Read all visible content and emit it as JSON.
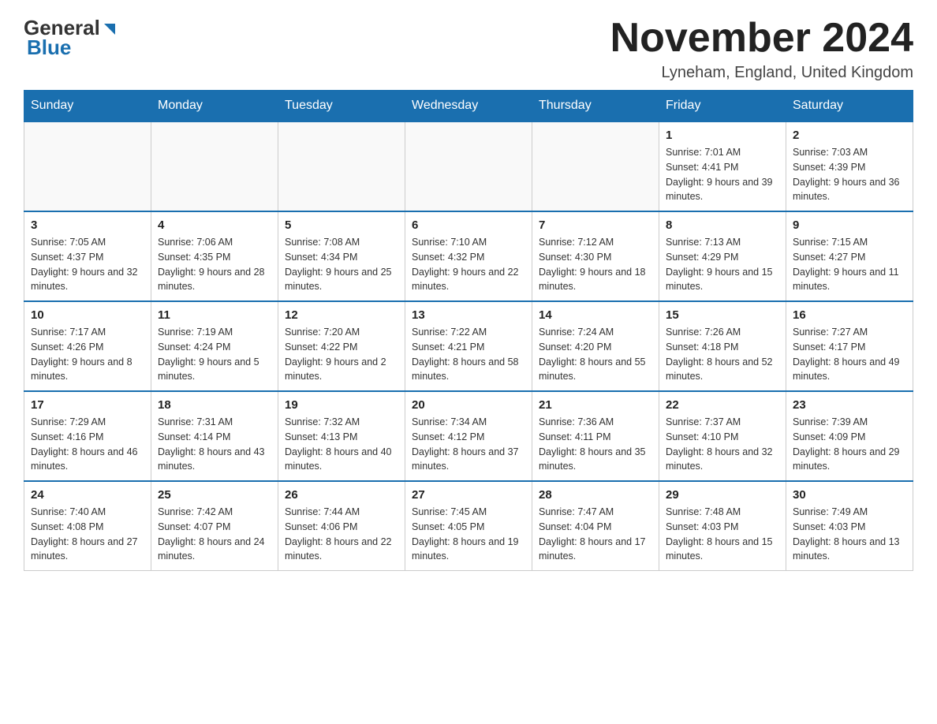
{
  "header": {
    "logo_text_general": "General",
    "logo_text_blue": "Blue",
    "month_title": "November 2024",
    "location": "Lyneham, England, United Kingdom"
  },
  "days_of_week": [
    "Sunday",
    "Monday",
    "Tuesday",
    "Wednesday",
    "Thursday",
    "Friday",
    "Saturday"
  ],
  "weeks": [
    [
      {
        "day": "",
        "sunrise": "",
        "sunset": "",
        "daylight": "",
        "empty": true
      },
      {
        "day": "",
        "sunrise": "",
        "sunset": "",
        "daylight": "",
        "empty": true
      },
      {
        "day": "",
        "sunrise": "",
        "sunset": "",
        "daylight": "",
        "empty": true
      },
      {
        "day": "",
        "sunrise": "",
        "sunset": "",
        "daylight": "",
        "empty": true
      },
      {
        "day": "",
        "sunrise": "",
        "sunset": "",
        "daylight": "",
        "empty": true
      },
      {
        "day": "1",
        "sunrise": "Sunrise: 7:01 AM",
        "sunset": "Sunset: 4:41 PM",
        "daylight": "Daylight: 9 hours and 39 minutes.",
        "empty": false
      },
      {
        "day": "2",
        "sunrise": "Sunrise: 7:03 AM",
        "sunset": "Sunset: 4:39 PM",
        "daylight": "Daylight: 9 hours and 36 minutes.",
        "empty": false
      }
    ],
    [
      {
        "day": "3",
        "sunrise": "Sunrise: 7:05 AM",
        "sunset": "Sunset: 4:37 PM",
        "daylight": "Daylight: 9 hours and 32 minutes.",
        "empty": false
      },
      {
        "day": "4",
        "sunrise": "Sunrise: 7:06 AM",
        "sunset": "Sunset: 4:35 PM",
        "daylight": "Daylight: 9 hours and 28 minutes.",
        "empty": false
      },
      {
        "day": "5",
        "sunrise": "Sunrise: 7:08 AM",
        "sunset": "Sunset: 4:34 PM",
        "daylight": "Daylight: 9 hours and 25 minutes.",
        "empty": false
      },
      {
        "day": "6",
        "sunrise": "Sunrise: 7:10 AM",
        "sunset": "Sunset: 4:32 PM",
        "daylight": "Daylight: 9 hours and 22 minutes.",
        "empty": false
      },
      {
        "day": "7",
        "sunrise": "Sunrise: 7:12 AM",
        "sunset": "Sunset: 4:30 PM",
        "daylight": "Daylight: 9 hours and 18 minutes.",
        "empty": false
      },
      {
        "day": "8",
        "sunrise": "Sunrise: 7:13 AM",
        "sunset": "Sunset: 4:29 PM",
        "daylight": "Daylight: 9 hours and 15 minutes.",
        "empty": false
      },
      {
        "day": "9",
        "sunrise": "Sunrise: 7:15 AM",
        "sunset": "Sunset: 4:27 PM",
        "daylight": "Daylight: 9 hours and 11 minutes.",
        "empty": false
      }
    ],
    [
      {
        "day": "10",
        "sunrise": "Sunrise: 7:17 AM",
        "sunset": "Sunset: 4:26 PM",
        "daylight": "Daylight: 9 hours and 8 minutes.",
        "empty": false
      },
      {
        "day": "11",
        "sunrise": "Sunrise: 7:19 AM",
        "sunset": "Sunset: 4:24 PM",
        "daylight": "Daylight: 9 hours and 5 minutes.",
        "empty": false
      },
      {
        "day": "12",
        "sunrise": "Sunrise: 7:20 AM",
        "sunset": "Sunset: 4:22 PM",
        "daylight": "Daylight: 9 hours and 2 minutes.",
        "empty": false
      },
      {
        "day": "13",
        "sunrise": "Sunrise: 7:22 AM",
        "sunset": "Sunset: 4:21 PM",
        "daylight": "Daylight: 8 hours and 58 minutes.",
        "empty": false
      },
      {
        "day": "14",
        "sunrise": "Sunrise: 7:24 AM",
        "sunset": "Sunset: 4:20 PM",
        "daylight": "Daylight: 8 hours and 55 minutes.",
        "empty": false
      },
      {
        "day": "15",
        "sunrise": "Sunrise: 7:26 AM",
        "sunset": "Sunset: 4:18 PM",
        "daylight": "Daylight: 8 hours and 52 minutes.",
        "empty": false
      },
      {
        "day": "16",
        "sunrise": "Sunrise: 7:27 AM",
        "sunset": "Sunset: 4:17 PM",
        "daylight": "Daylight: 8 hours and 49 minutes.",
        "empty": false
      }
    ],
    [
      {
        "day": "17",
        "sunrise": "Sunrise: 7:29 AM",
        "sunset": "Sunset: 4:16 PM",
        "daylight": "Daylight: 8 hours and 46 minutes.",
        "empty": false
      },
      {
        "day": "18",
        "sunrise": "Sunrise: 7:31 AM",
        "sunset": "Sunset: 4:14 PM",
        "daylight": "Daylight: 8 hours and 43 minutes.",
        "empty": false
      },
      {
        "day": "19",
        "sunrise": "Sunrise: 7:32 AM",
        "sunset": "Sunset: 4:13 PM",
        "daylight": "Daylight: 8 hours and 40 minutes.",
        "empty": false
      },
      {
        "day": "20",
        "sunrise": "Sunrise: 7:34 AM",
        "sunset": "Sunset: 4:12 PM",
        "daylight": "Daylight: 8 hours and 37 minutes.",
        "empty": false
      },
      {
        "day": "21",
        "sunrise": "Sunrise: 7:36 AM",
        "sunset": "Sunset: 4:11 PM",
        "daylight": "Daylight: 8 hours and 35 minutes.",
        "empty": false
      },
      {
        "day": "22",
        "sunrise": "Sunrise: 7:37 AM",
        "sunset": "Sunset: 4:10 PM",
        "daylight": "Daylight: 8 hours and 32 minutes.",
        "empty": false
      },
      {
        "day": "23",
        "sunrise": "Sunrise: 7:39 AM",
        "sunset": "Sunset: 4:09 PM",
        "daylight": "Daylight: 8 hours and 29 minutes.",
        "empty": false
      }
    ],
    [
      {
        "day": "24",
        "sunrise": "Sunrise: 7:40 AM",
        "sunset": "Sunset: 4:08 PM",
        "daylight": "Daylight: 8 hours and 27 minutes.",
        "empty": false
      },
      {
        "day": "25",
        "sunrise": "Sunrise: 7:42 AM",
        "sunset": "Sunset: 4:07 PM",
        "daylight": "Daylight: 8 hours and 24 minutes.",
        "empty": false
      },
      {
        "day": "26",
        "sunrise": "Sunrise: 7:44 AM",
        "sunset": "Sunset: 4:06 PM",
        "daylight": "Daylight: 8 hours and 22 minutes.",
        "empty": false
      },
      {
        "day": "27",
        "sunrise": "Sunrise: 7:45 AM",
        "sunset": "Sunset: 4:05 PM",
        "daylight": "Daylight: 8 hours and 19 minutes.",
        "empty": false
      },
      {
        "day": "28",
        "sunrise": "Sunrise: 7:47 AM",
        "sunset": "Sunset: 4:04 PM",
        "daylight": "Daylight: 8 hours and 17 minutes.",
        "empty": false
      },
      {
        "day": "29",
        "sunrise": "Sunrise: 7:48 AM",
        "sunset": "Sunset: 4:03 PM",
        "daylight": "Daylight: 8 hours and 15 minutes.",
        "empty": false
      },
      {
        "day": "30",
        "sunrise": "Sunrise: 7:49 AM",
        "sunset": "Sunset: 4:03 PM",
        "daylight": "Daylight: 8 hours and 13 minutes.",
        "empty": false
      }
    ]
  ]
}
